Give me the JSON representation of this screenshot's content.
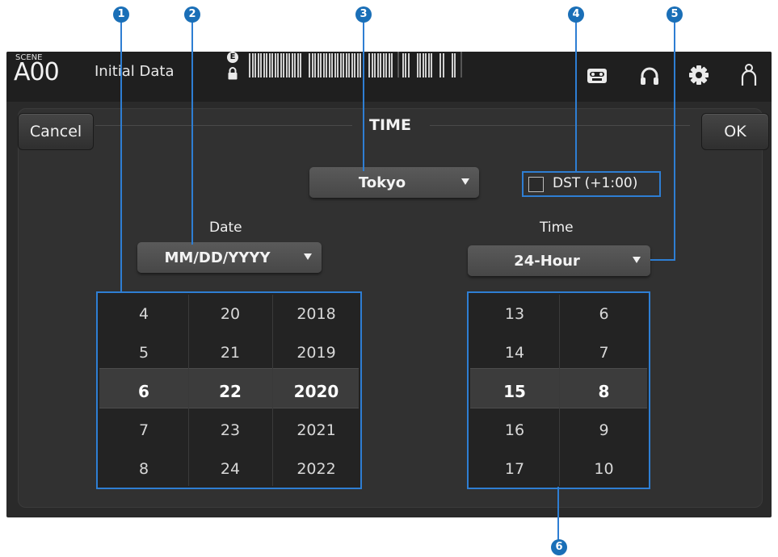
{
  "callouts": [
    "1",
    "2",
    "3",
    "4",
    "5",
    "6"
  ],
  "header": {
    "scene_label": "SCENE",
    "scene_number": "A00",
    "scene_name": "Initial Data",
    "edit_badge": "E"
  },
  "dialog": {
    "title": "TIME",
    "cancel_label": "Cancel",
    "ok_label": "OK"
  },
  "timezone": {
    "value": "Tokyo"
  },
  "dst": {
    "label": "DST (+1:00)",
    "checked": false
  },
  "date": {
    "label": "Date",
    "format": "MM/DD/YYYY",
    "months": [
      "4",
      "5",
      "6",
      "7",
      "8"
    ],
    "days": [
      "20",
      "21",
      "22",
      "23",
      "24"
    ],
    "years": [
      "2018",
      "2019",
      "2020",
      "2021",
      "2022"
    ],
    "selected_index": 2
  },
  "time": {
    "label": "Time",
    "format": "24-Hour",
    "hours": [
      "13",
      "14",
      "15",
      "16",
      "17"
    ],
    "minutes": [
      "6",
      "7",
      "8",
      "9",
      "10"
    ],
    "selected_index": 2
  },
  "colors": {
    "callout": "#1a6fb7",
    "highlight": "#2e7ed3",
    "panel": "#313131"
  },
  "icons": [
    "lock-icon",
    "tape-recorder-icon",
    "headphones-icon",
    "gear-icon",
    "user-icon"
  ]
}
